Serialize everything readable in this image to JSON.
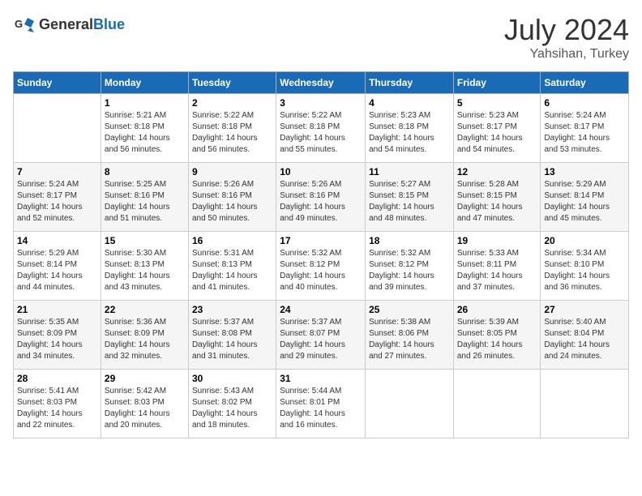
{
  "header": {
    "logo_general": "General",
    "logo_blue": "Blue",
    "month_year": "July 2024",
    "location": "Yahsihan, Turkey"
  },
  "calendar": {
    "days_of_week": [
      "Sunday",
      "Monday",
      "Tuesday",
      "Wednesday",
      "Thursday",
      "Friday",
      "Saturday"
    ],
    "weeks": [
      [
        {
          "num": "",
          "info": ""
        },
        {
          "num": "1",
          "info": "Sunrise: 5:21 AM\nSunset: 8:18 PM\nDaylight: 14 hours\nand 56 minutes."
        },
        {
          "num": "2",
          "info": "Sunrise: 5:22 AM\nSunset: 8:18 PM\nDaylight: 14 hours\nand 56 minutes."
        },
        {
          "num": "3",
          "info": "Sunrise: 5:22 AM\nSunset: 8:18 PM\nDaylight: 14 hours\nand 55 minutes."
        },
        {
          "num": "4",
          "info": "Sunrise: 5:23 AM\nSunset: 8:18 PM\nDaylight: 14 hours\nand 54 minutes."
        },
        {
          "num": "5",
          "info": "Sunrise: 5:23 AM\nSunset: 8:17 PM\nDaylight: 14 hours\nand 54 minutes."
        },
        {
          "num": "6",
          "info": "Sunrise: 5:24 AM\nSunset: 8:17 PM\nDaylight: 14 hours\nand 53 minutes."
        }
      ],
      [
        {
          "num": "7",
          "info": "Sunrise: 5:24 AM\nSunset: 8:17 PM\nDaylight: 14 hours\nand 52 minutes."
        },
        {
          "num": "8",
          "info": "Sunrise: 5:25 AM\nSunset: 8:16 PM\nDaylight: 14 hours\nand 51 minutes."
        },
        {
          "num": "9",
          "info": "Sunrise: 5:26 AM\nSunset: 8:16 PM\nDaylight: 14 hours\nand 50 minutes."
        },
        {
          "num": "10",
          "info": "Sunrise: 5:26 AM\nSunset: 8:16 PM\nDaylight: 14 hours\nand 49 minutes."
        },
        {
          "num": "11",
          "info": "Sunrise: 5:27 AM\nSunset: 8:15 PM\nDaylight: 14 hours\nand 48 minutes."
        },
        {
          "num": "12",
          "info": "Sunrise: 5:28 AM\nSunset: 8:15 PM\nDaylight: 14 hours\nand 47 minutes."
        },
        {
          "num": "13",
          "info": "Sunrise: 5:29 AM\nSunset: 8:14 PM\nDaylight: 14 hours\nand 45 minutes."
        }
      ],
      [
        {
          "num": "14",
          "info": "Sunrise: 5:29 AM\nSunset: 8:14 PM\nDaylight: 14 hours\nand 44 minutes."
        },
        {
          "num": "15",
          "info": "Sunrise: 5:30 AM\nSunset: 8:13 PM\nDaylight: 14 hours\nand 43 minutes."
        },
        {
          "num": "16",
          "info": "Sunrise: 5:31 AM\nSunset: 8:13 PM\nDaylight: 14 hours\nand 41 minutes."
        },
        {
          "num": "17",
          "info": "Sunrise: 5:32 AM\nSunset: 8:12 PM\nDaylight: 14 hours\nand 40 minutes."
        },
        {
          "num": "18",
          "info": "Sunrise: 5:32 AM\nSunset: 8:12 PM\nDaylight: 14 hours\nand 39 minutes."
        },
        {
          "num": "19",
          "info": "Sunrise: 5:33 AM\nSunset: 8:11 PM\nDaylight: 14 hours\nand 37 minutes."
        },
        {
          "num": "20",
          "info": "Sunrise: 5:34 AM\nSunset: 8:10 PM\nDaylight: 14 hours\nand 36 minutes."
        }
      ],
      [
        {
          "num": "21",
          "info": "Sunrise: 5:35 AM\nSunset: 8:09 PM\nDaylight: 14 hours\nand 34 minutes."
        },
        {
          "num": "22",
          "info": "Sunrise: 5:36 AM\nSunset: 8:09 PM\nDaylight: 14 hours\nand 32 minutes."
        },
        {
          "num": "23",
          "info": "Sunrise: 5:37 AM\nSunset: 8:08 PM\nDaylight: 14 hours\nand 31 minutes."
        },
        {
          "num": "24",
          "info": "Sunrise: 5:37 AM\nSunset: 8:07 PM\nDaylight: 14 hours\nand 29 minutes."
        },
        {
          "num": "25",
          "info": "Sunrise: 5:38 AM\nSunset: 8:06 PM\nDaylight: 14 hours\nand 27 minutes."
        },
        {
          "num": "26",
          "info": "Sunrise: 5:39 AM\nSunset: 8:05 PM\nDaylight: 14 hours\nand 26 minutes."
        },
        {
          "num": "27",
          "info": "Sunrise: 5:40 AM\nSunset: 8:04 PM\nDaylight: 14 hours\nand 24 minutes."
        }
      ],
      [
        {
          "num": "28",
          "info": "Sunrise: 5:41 AM\nSunset: 8:03 PM\nDaylight: 14 hours\nand 22 minutes."
        },
        {
          "num": "29",
          "info": "Sunrise: 5:42 AM\nSunset: 8:03 PM\nDaylight: 14 hours\nand 20 minutes."
        },
        {
          "num": "30",
          "info": "Sunrise: 5:43 AM\nSunset: 8:02 PM\nDaylight: 14 hours\nand 18 minutes."
        },
        {
          "num": "31",
          "info": "Sunrise: 5:44 AM\nSunset: 8:01 PM\nDaylight: 14 hours\nand 16 minutes."
        },
        {
          "num": "",
          "info": ""
        },
        {
          "num": "",
          "info": ""
        },
        {
          "num": "",
          "info": ""
        }
      ]
    ]
  }
}
